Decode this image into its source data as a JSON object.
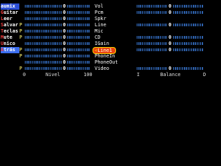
{
  "menu": [
    {
      "label": "aumix",
      "hot": "",
      "rest": "aumix",
      "state": "selected"
    },
    {
      "label": "Guitar",
      "hot": "G",
      "rest": "uitar"
    },
    {
      "label": "Leer",
      "hot": "L",
      "rest": "eer"
    },
    {
      "label": "Salvar",
      "hot": "S",
      "rest": "alvar"
    },
    {
      "label": "Teclas",
      "hot": "T",
      "rest": "eclas"
    },
    {
      "label": "Mute",
      "hot": "M",
      "rest": "ute"
    },
    {
      "label": "Unico",
      "hot": "U",
      "rest": "nico"
    },
    {
      "label": "Atrás",
      "hot": "A",
      "rest": "trás",
      "state": "highlight"
    }
  ],
  "channels": [
    {
      "name": "Vol",
      "level": "0",
      "pm": "",
      "balance": "0"
    },
    {
      "name": "Pcm",
      "level": "0",
      "pm": "",
      "balance": "0"
    },
    {
      "name": "Spkr",
      "level": "0",
      "pm": "",
      "balance": ""
    },
    {
      "name": "Line",
      "level": "0",
      "pm": "P",
      "balance": "0"
    },
    {
      "name": "Mic",
      "level": "0",
      "pm": "P",
      "balance": ""
    },
    {
      "name": "CD",
      "level": "0",
      "pm": "P",
      "balance": "0"
    },
    {
      "name": "IGain",
      "level": "0",
      "pm": "",
      "balance": "0"
    },
    {
      "name": "Line1",
      "level": "0",
      "pm": "P",
      "balance": "0",
      "selected": true
    },
    {
      "name": "PhoneIn",
      "level": "0",
      "pm": "P",
      "balance": ""
    },
    {
      "name": "PhoneOut",
      "level": "0",
      "pm": "",
      "balance": ""
    },
    {
      "name": "Video",
      "level": "0",
      "pm": "P",
      "balance": "0"
    }
  ],
  "scale": {
    "level_min": "0",
    "level_label": "Nivel",
    "level_max": "100",
    "balance_left": "I",
    "balance_label": "Balance",
    "balance_right": "D"
  },
  "colors": {
    "bar": "#3a7ad8",
    "menu_selected": "#2d4fd6",
    "menu_hotkey": "#f23a3a",
    "record_marker": "#c9c25a",
    "selected_channel": "#e9440f"
  }
}
